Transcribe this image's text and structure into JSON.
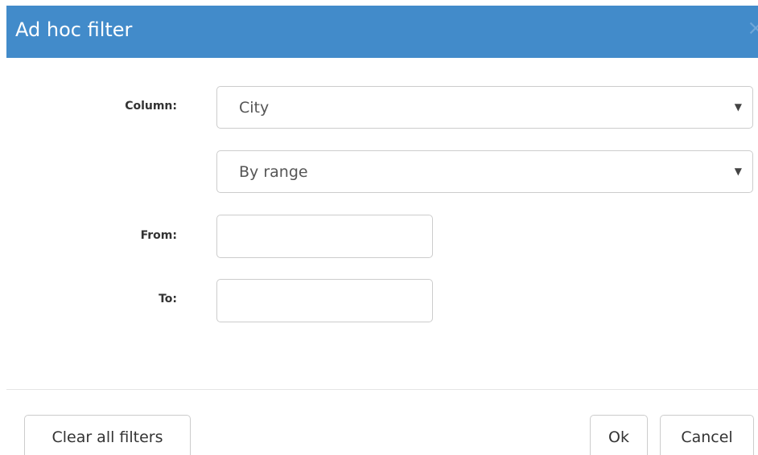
{
  "dialog": {
    "title": "Ad hoc filter",
    "close_icon": "×"
  },
  "form": {
    "column_label": "Column:",
    "column_value": "City",
    "filter_type_value": "By range",
    "from_label": "From:",
    "from_value": "",
    "to_label": "To:",
    "to_value": "",
    "dropdown_arrow": "▼"
  },
  "footer": {
    "clear_label": "Clear all filters",
    "ok_label": "Ok",
    "cancel_label": "Cancel"
  },
  "colors": {
    "header": "#428bca",
    "border": "#cccccc"
  }
}
